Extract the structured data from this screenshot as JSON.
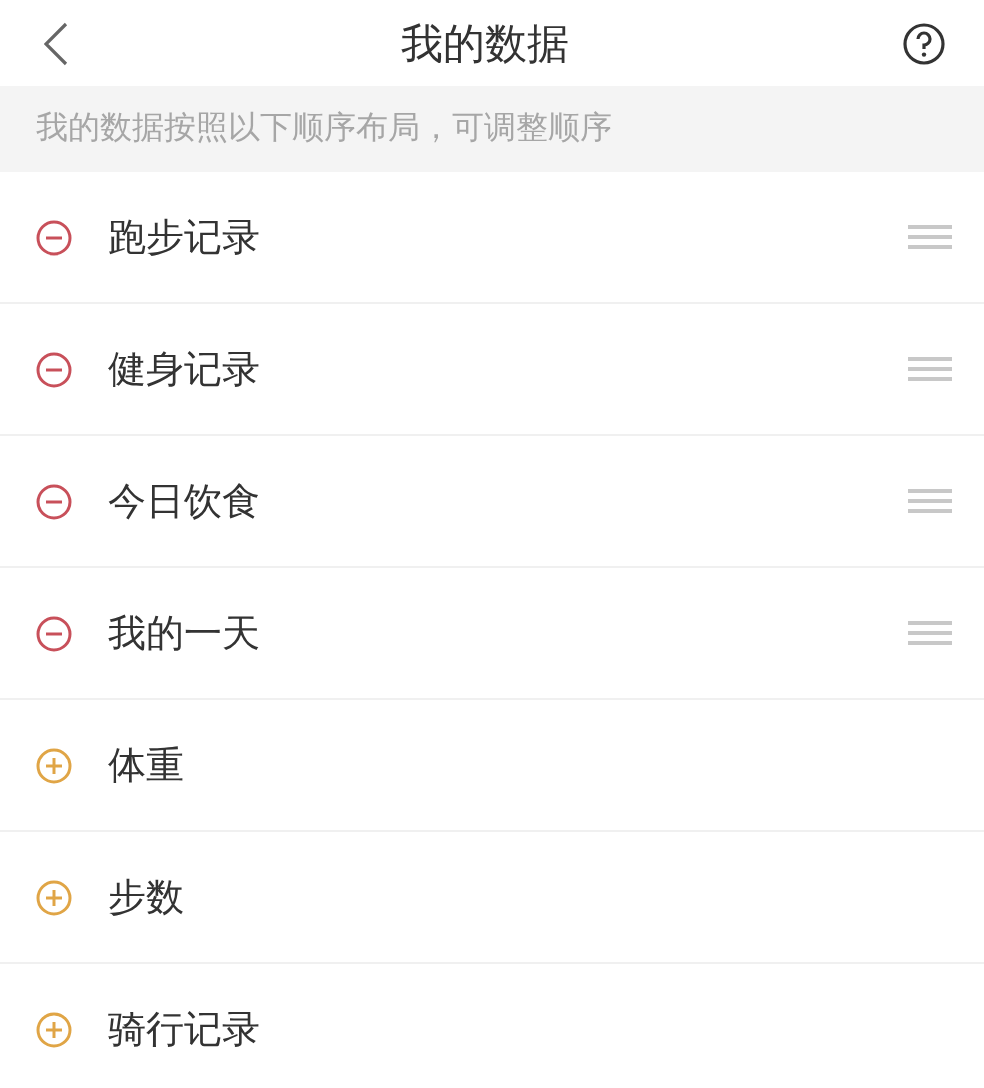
{
  "header": {
    "title": "我的数据"
  },
  "notice": "我的数据按照以下顺序布局，可调整顺序",
  "items": [
    {
      "label": "跑步记录",
      "added": true
    },
    {
      "label": "健身记录",
      "added": true
    },
    {
      "label": "今日饮食",
      "added": true
    },
    {
      "label": "我的一天",
      "added": true
    },
    {
      "label": "体重",
      "added": false
    },
    {
      "label": "步数",
      "added": false
    },
    {
      "label": "骑行记录",
      "added": false
    }
  ]
}
